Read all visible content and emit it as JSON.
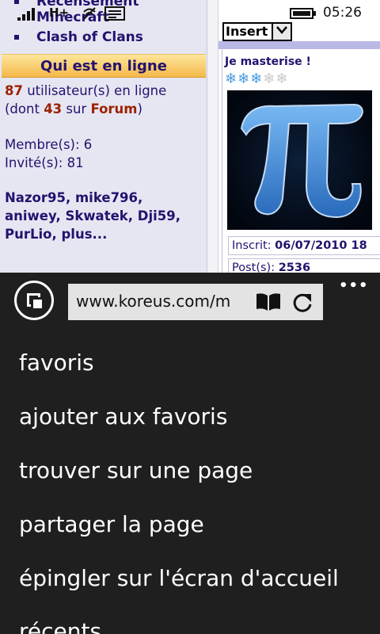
{
  "status_bar": {
    "network_type": "H+",
    "time": "05:26",
    "icons": [
      "signal-icon",
      "wifi-icon",
      "message-icon",
      "battery-icon"
    ]
  },
  "webpage": {
    "menu_items": [
      "Recensement",
      "Minecraft",
      "Clash of Clans"
    ],
    "online_title": "Qui est en ligne",
    "stats": {
      "users_count": "87",
      "users_text": " utilisateur(s) en ligne",
      "paren_open": "(dont ",
      "forum_count": "43",
      "forum_mid": " sur ",
      "forum_link": "Forum",
      "paren_close": ")",
      "members": "Membre(s): 6",
      "guests": "Invité(s): 81"
    },
    "online_users_line1": "Nazor95, mike796,",
    "online_users_line2": "aniwey, Skwatek, Dji59,",
    "online_users_line3": "PurLio, plus...",
    "insert_select": "Insert",
    "post": {
      "title": "Je masterise !",
      "snowflakes_active": "❄❄❄",
      "snowflakes_inactive": "❄❄",
      "registered_label": "Inscrit: ",
      "registered_value": "06/07/2010 18",
      "posts_label": "Post(s): ",
      "posts_value": "2536"
    },
    "colors": {
      "link": "#23126e",
      "accent_red": "#9b2200",
      "header_orange": "#f5b84a"
    }
  },
  "browser": {
    "address": "www.koreus.com/m",
    "more_label": "•••",
    "menu": [
      "favoris",
      "ajouter aux favoris",
      "trouver sur une page",
      "partager la page",
      "épingler sur l'écran d'accueil",
      "récents"
    ]
  }
}
